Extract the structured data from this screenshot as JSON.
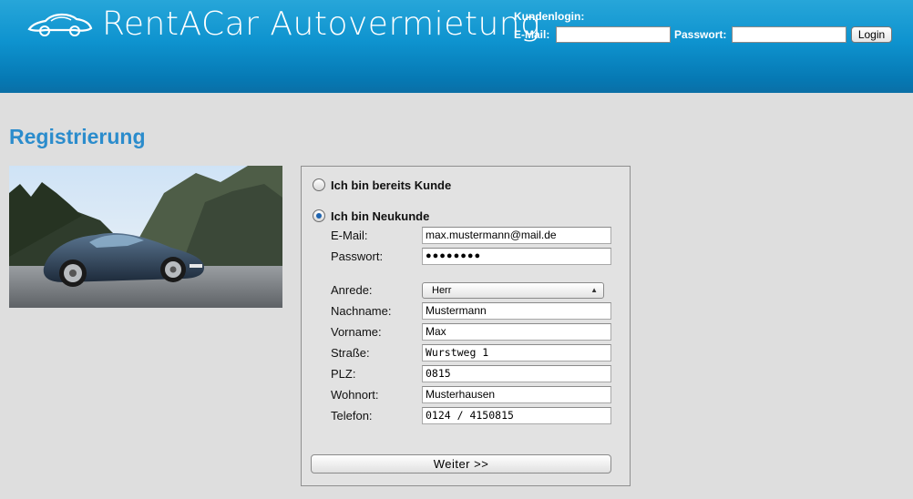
{
  "header": {
    "brand": "RentACar Autovermietung",
    "login": {
      "title": "Kundenlogin:",
      "email_label": "E-Mail:",
      "email_value": "",
      "password_label": "Passwort:",
      "password_value": "",
      "button": "Login"
    }
  },
  "page_title": "Registrierung",
  "form": {
    "options": [
      {
        "label": "Ich bin bereits Kunde",
        "selected": false
      },
      {
        "label": "Ich bin Neukunde",
        "selected": true
      }
    ],
    "account": {
      "email_label": "E-Mail:",
      "email_value": "max.mustermann@mail.de",
      "password_label": "Passwort:",
      "password_mask": "●●●●●●●●"
    },
    "anrede_label": "Anrede:",
    "anrede_value": "Herr",
    "fields": [
      {
        "label": "Nachname:",
        "value": "Mustermann"
      },
      {
        "label": "Vorname:",
        "value": "Max"
      },
      {
        "label": "Straße:",
        "value": "Wurstweg 1"
      },
      {
        "label": "PLZ:",
        "value": "0815"
      },
      {
        "label": "Wohnort:",
        "value": "Musterhausen"
      },
      {
        "label": "Telefon:",
        "value": "0124 / 4150815"
      }
    ],
    "submit": "Weiter >>"
  },
  "colors": {
    "header_top": "#27a6d9",
    "header_bottom": "#0a6fa6",
    "title_blue": "#2b8ccc",
    "background": "#dedede"
  },
  "icons": {
    "logo": "car-logo-icon",
    "select_arrow": "updown-arrow-icon"
  }
}
